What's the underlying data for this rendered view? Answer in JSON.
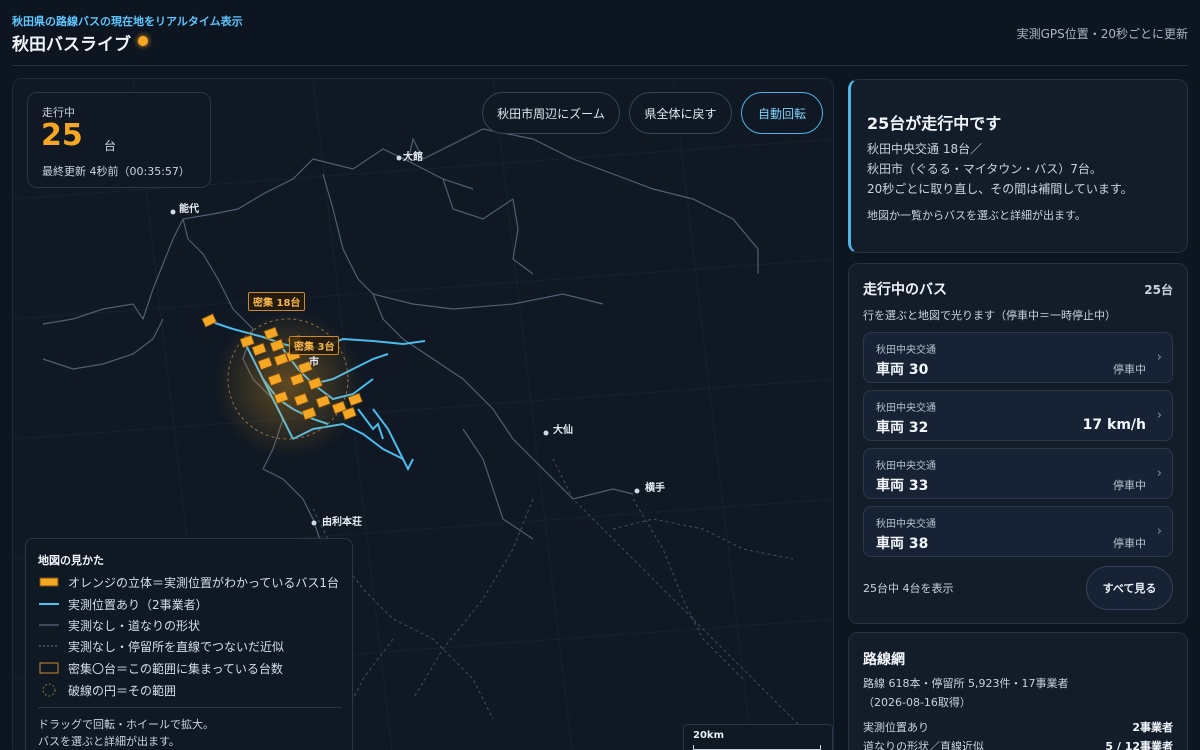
{
  "header": {
    "tagline": "秋田県の路線バスの現在地をリアルタイム表示",
    "title": "秋田バスライブ",
    "update_note": "実測GPS位置・20秒ごとに更新"
  },
  "map": {
    "stats": {
      "label": "走行中",
      "count": "25",
      "unit": "台",
      "updated": "最終更新 4秒前（00:35:57）"
    },
    "buttons": {
      "zoom_akita": "秋田市周辺にズーム",
      "back_to_pref": "県全体に戻す",
      "auto_rotate": "自動回転"
    },
    "cities": {
      "odate": "大館",
      "noshiro": "能代",
      "akita": "市",
      "omagari": "大仙",
      "yokote": "横手",
      "yurihonjo": "由利本荘"
    },
    "clusters": {
      "big": "密集 18台",
      "small": "密集 3台"
    },
    "legend": {
      "title": "地図の見かた",
      "items": {
        "bus": "オレンジの立体＝実測位置がわかっているバス1台",
        "live_route": "実測位置あり（2事業者）",
        "road_shape": "実測なし・道なりの形状",
        "straight": "実測なし・停留所を直線でつないだ近似",
        "cluster": "密集〇台＝この範囲に集まっている台数",
        "circle": "破線の円＝その範囲"
      },
      "help1": "ドラッグで回転・ホイールで拡大。",
      "help2": "バスを選ぶと詳細が出ます。"
    },
    "scale": "20km"
  },
  "summary": {
    "title": "25台が走行中です",
    "line1": "秋田中央交通 18台／",
    "line2": "秋田市（ぐるる・マイタウン・バス）7台。",
    "line3": "20秒ごとに取り直し、その間は補間しています。",
    "hint": "地図か一覧からバスを選ぶと詳細が出ます。"
  },
  "buslist": {
    "title": "走行中のバス",
    "count": "25台",
    "desc": "行を選ぶと地図で光ります（停車中＝一時停止中）",
    "items": [
      {
        "operator": "秋田中央交通",
        "name": "車両 30",
        "status": "停車中"
      },
      {
        "operator": "秋田中央交通",
        "name": "車両 32",
        "status": "17 km/h"
      },
      {
        "operator": "秋田中央交通",
        "name": "車両 33",
        "status": "停車中"
      },
      {
        "operator": "秋田中央交通",
        "name": "車両 38",
        "status": "停車中"
      }
    ],
    "footer": "25台中 4台を表示",
    "see_all": "すべて見る"
  },
  "network": {
    "title": "路線網",
    "line1": "路線 618本・停留所 5,923件・17事業者",
    "line2": "（2026-08-16取得）",
    "rows": [
      {
        "label": "実測位置あり",
        "value": "2事業者"
      },
      {
        "label": "道なりの形状／直線近似",
        "value": "5 / 12事業者"
      }
    ]
  },
  "colors": {
    "accent": "#4fb3ea",
    "bus": "#f5a623",
    "background": "#0d1520"
  }
}
